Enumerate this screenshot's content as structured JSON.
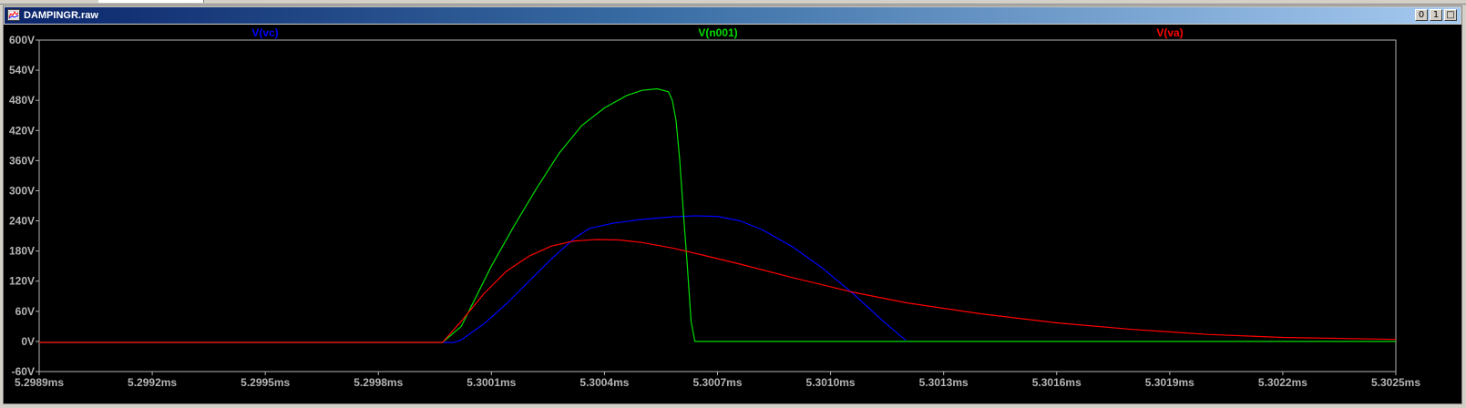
{
  "window": {
    "title": "DAMPINGR.raw",
    "buttons": [
      "0",
      "1",
      "□"
    ]
  },
  "colors": {
    "vc": "#0000ff",
    "n001": "#00dd00",
    "va": "#ff0000",
    "axis": "#b4b4b4",
    "background": "#000000"
  },
  "icons": {
    "window_icon": "waveform-icon"
  },
  "chart_data": {
    "type": "line",
    "title": "",
    "xlabel": "",
    "ylabel": "",
    "xlim": [
      5.2989,
      5.3025
    ],
    "ylim": [
      -60,
      600
    ],
    "grid": false,
    "legend_position": "top",
    "x_ticks": [
      "5.2989ms",
      "5.2992ms",
      "5.2995ms",
      "5.2998ms",
      "5.3001ms",
      "5.3004ms",
      "5.3007ms",
      "5.3010ms",
      "5.3013ms",
      "5.3016ms",
      "5.3019ms",
      "5.3022ms",
      "5.3025ms"
    ],
    "y_ticks": [
      "600V",
      "540V",
      "480V",
      "420V",
      "360V",
      "300V",
      "240V",
      "180V",
      "120V",
      "60V",
      "0V",
      "-60V"
    ],
    "series": [
      {
        "name": "V(vc)",
        "color": "#0000ff",
        "x": [
          5.2989,
          5.3,
          5.30002,
          5.30008,
          5.30014,
          5.3002,
          5.30026,
          5.30032,
          5.30036,
          5.30042,
          5.3005,
          5.30058,
          5.30064,
          5.3007,
          5.30076,
          5.30082,
          5.3009,
          5.30098,
          5.30106,
          5.30114,
          5.3012
        ],
        "y": [
          -2,
          -2,
          3,
          35,
          75,
          120,
          165,
          205,
          225,
          235,
          243,
          248,
          250,
          249,
          240,
          222,
          188,
          145,
          95,
          40,
          2
        ]
      },
      {
        "name": "V(n001)",
        "color": "#00dd00",
        "x": [
          5.2989,
          5.29997,
          5.30002,
          5.30006,
          5.3001,
          5.30016,
          5.30022,
          5.30028,
          5.30034,
          5.3004,
          5.30046,
          5.3005,
          5.30054,
          5.30057,
          5.30058,
          5.30059,
          5.3006,
          5.30061,
          5.30062,
          5.30063,
          5.30064,
          5.3012,
          5.3018,
          5.3025
        ],
        "y": [
          -2,
          -2,
          30,
          90,
          150,
          230,
          305,
          375,
          430,
          465,
          490,
          500,
          503,
          497,
          480,
          440,
          360,
          250,
          150,
          40,
          0,
          0,
          0,
          0
        ]
      },
      {
        "name": "V(va)",
        "color": "#ff0000",
        "x": [
          5.2989,
          5.29997,
          5.30002,
          5.30008,
          5.30014,
          5.3002,
          5.30026,
          5.30032,
          5.30038,
          5.30044,
          5.3005,
          5.30058,
          5.30066,
          5.30076,
          5.3009,
          5.30106,
          5.3012,
          5.3014,
          5.3016,
          5.3018,
          5.302,
          5.3022,
          5.3025
        ],
        "y": [
          -2,
          -2,
          40,
          95,
          140,
          170,
          190,
          200,
          203,
          202,
          197,
          186,
          172,
          154,
          127,
          98,
          77,
          55,
          37,
          24,
          14,
          8,
          4
        ]
      }
    ]
  }
}
